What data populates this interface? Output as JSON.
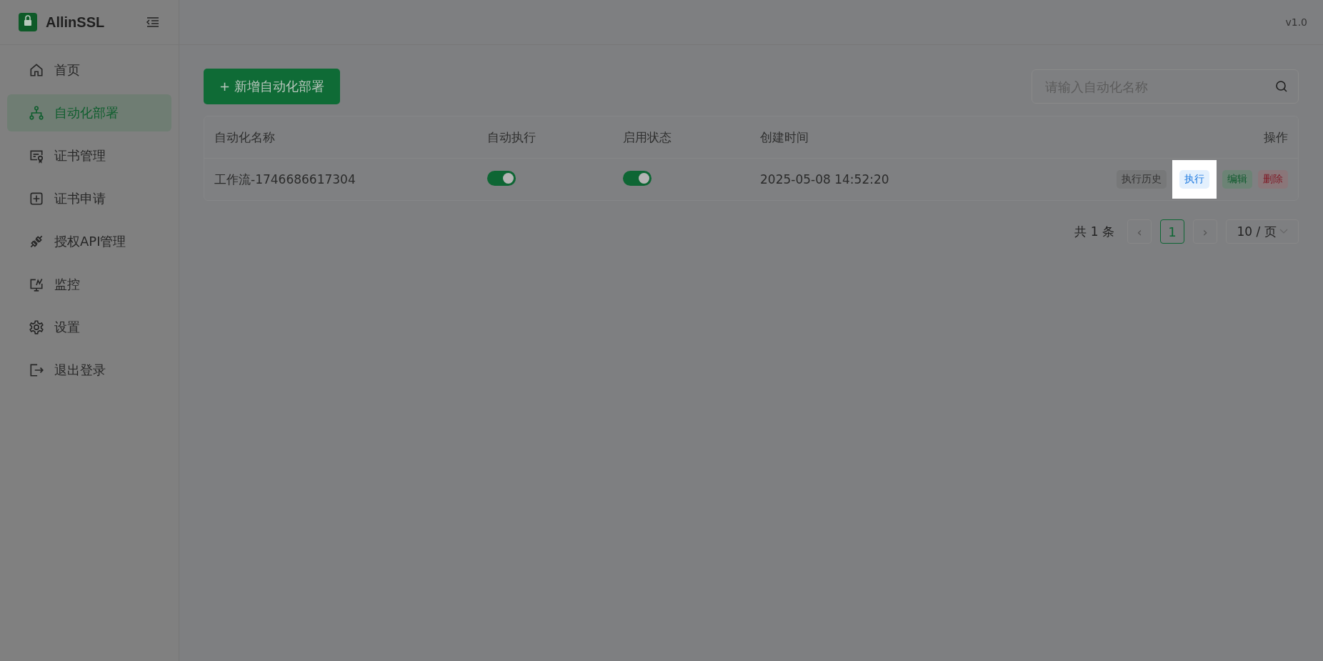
{
  "app": {
    "name": "AllinSSL",
    "version": "v1.0"
  },
  "sidebar": {
    "items": [
      {
        "label": "首页",
        "kind": "home",
        "selected": false
      },
      {
        "label": "自动化部署",
        "kind": "flow",
        "selected": true
      },
      {
        "label": "证书管理",
        "kind": "cert",
        "selected": false
      },
      {
        "label": "证书申请",
        "kind": "plus",
        "selected": false
      },
      {
        "label": "授权API管理",
        "kind": "plug",
        "selected": false
      },
      {
        "label": "监控",
        "kind": "monitor",
        "selected": false
      },
      {
        "label": "设置",
        "kind": "gear",
        "selected": false
      },
      {
        "label": "退出登录",
        "kind": "logout",
        "selected": false
      }
    ]
  },
  "add_button": {
    "label": "+ 新增自动化部署"
  },
  "search": {
    "placeholder": "请输入自动化名称"
  },
  "table": {
    "columns": [
      "自动化名称",
      "自动执行",
      "启用状态",
      "创建时间",
      "操作"
    ],
    "rows": [
      {
        "name": "工作流-1746686617304",
        "auto_run": {
          "on": true
        },
        "enabled": {
          "on": true
        },
        "created": "2025-05-08 14:52:20",
        "actions": [
          {
            "label": "执行历史",
            "kind": "default",
            "highlighted": false
          },
          {
            "label": "执行",
            "kind": "info",
            "highlighted": true
          },
          {
            "label": "编辑",
            "kind": "success",
            "highlighted": false
          },
          {
            "label": "删除",
            "kind": "error",
            "highlighted": false
          }
        ]
      }
    ]
  },
  "pagination": {
    "total": "共 1 条",
    "prev": "‹",
    "pages": [
      {
        "label": "1",
        "selected": true
      }
    ],
    "next": "›",
    "page_size": "10 / 页"
  }
}
